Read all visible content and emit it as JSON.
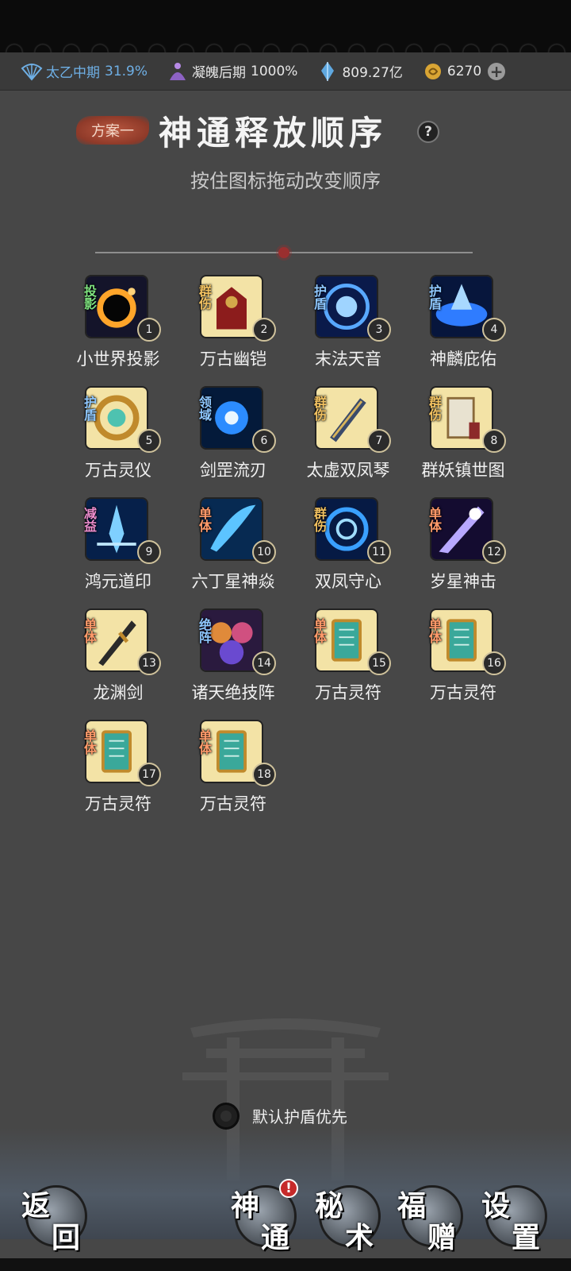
{
  "resources": {
    "realm": {
      "label": "太乙中期",
      "value": "31.9%"
    },
    "soul": {
      "label": "凝魄后期",
      "value": "1000%"
    },
    "spirit_stone": {
      "value": "809.27亿"
    },
    "gold": {
      "value": "6270"
    },
    "plus": "+"
  },
  "header": {
    "plan_label": "方案一",
    "title": "神通释放顺序",
    "help": "?",
    "subtitle": "按住图标拖动改变顺序"
  },
  "skills": [
    {
      "name": "小世界投影",
      "tag": "投影",
      "num": "1",
      "tag_color": "#7fe37f",
      "art": "blackhole"
    },
    {
      "name": "万古幽铠",
      "tag": "群伤",
      "num": "2",
      "tag_color": "#f0c060",
      "art": "armor"
    },
    {
      "name": "末法天音",
      "tag": "护盾",
      "num": "3",
      "tag_color": "#8fc8ff",
      "art": "shield"
    },
    {
      "name": "神麟庇佑",
      "tag": "护盾",
      "num": "4",
      "tag_color": "#8fc8ff",
      "art": "shield2"
    },
    {
      "name": "万古灵仪",
      "tag": "护盾",
      "num": "5",
      "tag_color": "#8fc8ff",
      "art": "ring"
    },
    {
      "name": "剑罡流刃",
      "tag": "领域",
      "num": "6",
      "tag_color": "#8fc8ff",
      "art": "burst"
    },
    {
      "name": "太虚双凤琴",
      "tag": "群伤",
      "num": "7",
      "tag_color": "#f0c060",
      "art": "qin"
    },
    {
      "name": "群妖镇世图",
      "tag": "群伤",
      "num": "8",
      "tag_color": "#f0c060",
      "art": "scroll"
    },
    {
      "name": "鸿元道印",
      "tag": "减益",
      "num": "9",
      "tag_color": "#f08fd0",
      "art": "crystal"
    },
    {
      "name": "六丁星神焱",
      "tag": "单体",
      "num": "10",
      "tag_color": "#ff9a6a",
      "art": "slash"
    },
    {
      "name": "双凤守心",
      "tag": "群伤",
      "num": "11",
      "tag_color": "#f0c060",
      "art": "vortex"
    },
    {
      "name": "岁星神击",
      "tag": "单体",
      "num": "12",
      "tag_color": "#ff9a6a",
      "art": "strike"
    },
    {
      "name": "龙渊剑",
      "tag": "单体",
      "num": "13",
      "tag_color": "#ff9a6a",
      "art": "sword"
    },
    {
      "name": "诸天绝技阵",
      "tag": "绝阵",
      "num": "14",
      "tag_color": "#8fc8ff",
      "art": "orbs"
    },
    {
      "name": "万古灵符",
      "tag": "单体",
      "num": "15",
      "tag_color": "#ff9a6a",
      "art": "talisman"
    },
    {
      "name": "万古灵符",
      "tag": "单体",
      "num": "16",
      "tag_color": "#ff9a6a",
      "art": "talisman"
    },
    {
      "name": "万古灵符",
      "tag": "单体",
      "num": "17",
      "tag_color": "#ff9a6a",
      "art": "talisman"
    },
    {
      "name": "万古灵符",
      "tag": "单体",
      "num": "18",
      "tag_color": "#ff9a6a",
      "art": "talisman"
    }
  ],
  "toggle": {
    "label": "默认护盾优先",
    "checked": false
  },
  "nav": {
    "back": {
      "c1": "返",
      "c2": "回"
    },
    "shentong": {
      "c1": "神",
      "c2": "通",
      "badge": "!"
    },
    "mishu": {
      "c1": "秘",
      "c2": "术"
    },
    "fuzeng": {
      "c1": "福",
      "c2": "赠"
    },
    "shezhi": {
      "c1": "设",
      "c2": "置"
    }
  }
}
